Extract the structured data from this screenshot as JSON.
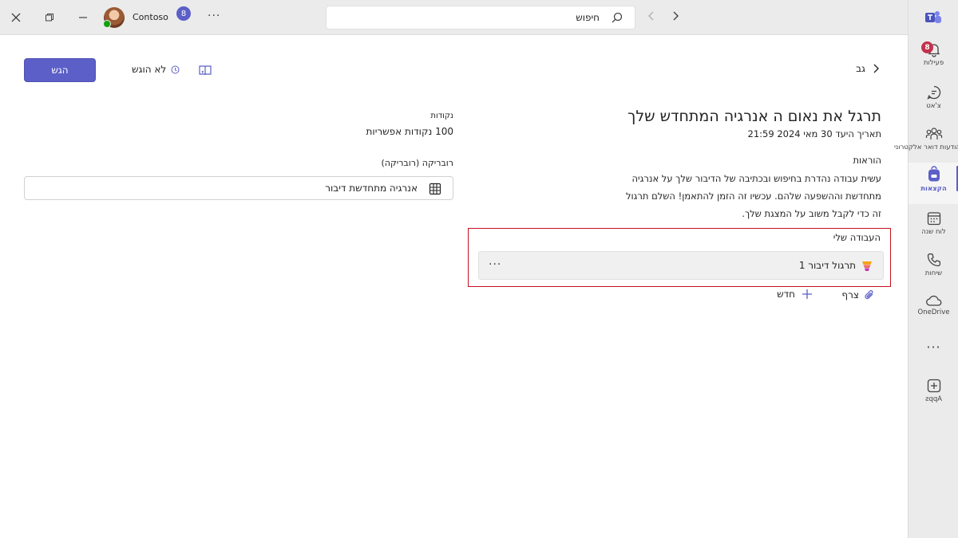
{
  "topbar": {
    "org_name": "Contoso",
    "org_badge": "8",
    "search_text": "חיפוש"
  },
  "rail": {
    "items": [
      {
        "label": "פעילות",
        "badge": "8",
        "icon": "bell-icon"
      },
      {
        "label": "צ'אט",
        "icon": "chat-icon"
      },
      {
        "label": "הודעות דואר אלקטרוני",
        "icon": "people-icon"
      },
      {
        "label": "הקצאות",
        "icon": "backpack-icon",
        "active": true
      },
      {
        "label": "לוח שנה",
        "icon": "calendar-icon"
      },
      {
        "label": "שיחות",
        "icon": "phone-icon"
      },
      {
        "label": "OneDrive",
        "icon": "cloud-icon"
      },
      {
        "label": "Apps",
        "icon": "add-icon"
      }
    ]
  },
  "header": {
    "back_label": "גב",
    "status_label": "לא הוגש",
    "submit_label": "הגש"
  },
  "assignment": {
    "title": "תרגל את נאום ה אנרגיה המתחדש שלך",
    "due": "תאריך היעד 30 מאי 2024 21:59",
    "instructions_label": "הוראות",
    "instructions_text": "עשית עבודה נהדרת בחיפוש ובכתיבה של הדיבור שלך על  אנרגיה מתחדשת וההשפעה שלהם. עכשיו זה הזמן להתאמן! השלם תרגול זה כדי לקבל משוב על המצגת שלך.",
    "points_label": "נקודות",
    "points_value": "100 נקודות אפשריות",
    "rubric_label": "רובריקה (רובריקה)",
    "rubric_name": "אנרגיה מתחדשת דיבור"
  },
  "my_work": {
    "label": "העבודה שלי",
    "item_name": "תרגול דיבור 1",
    "attach_label": "צרף",
    "new_label": "חדש"
  },
  "colors": {
    "accent": "#5b5fc7",
    "highlight_border": "#c50f1f",
    "badge": "#c4314b"
  }
}
